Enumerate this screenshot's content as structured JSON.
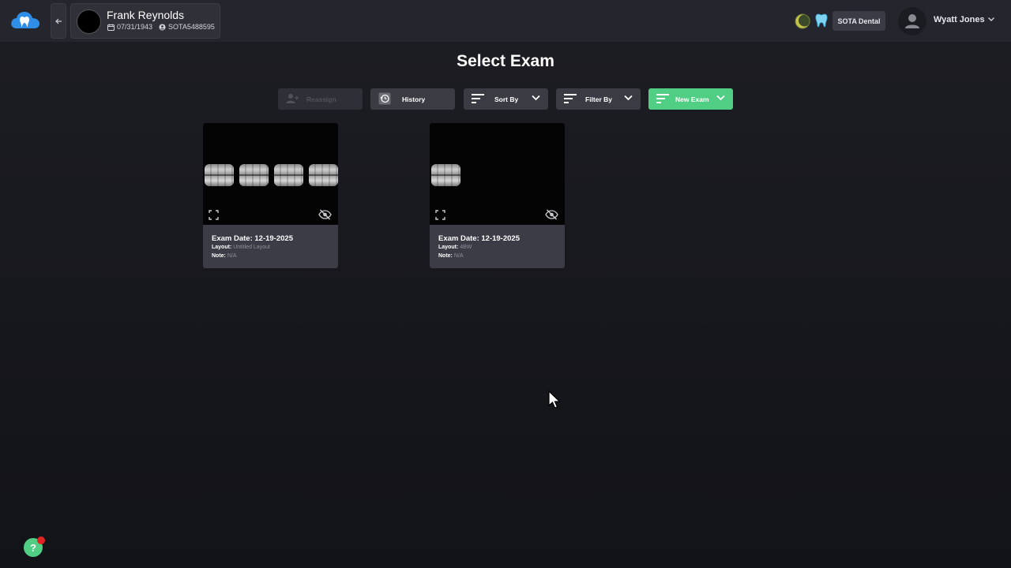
{
  "header": {
    "patient": {
      "name": "Frank Reynolds",
      "dob": "07/31/1943",
      "patient_id": "SOTA5488595"
    },
    "practice_label": "SOTA Dental",
    "user_name": "Wyatt Jones"
  },
  "page_title": "Select Exam",
  "toolbar": {
    "reassign_label": "Reassign",
    "history_label": "History",
    "sort_label": "Sort By",
    "filter_label": "Filter By",
    "new_exam_label": "New Exam"
  },
  "exams": [
    {
      "date_text": "Exam Date: 12-19-2025",
      "layout_label": "Layout:",
      "layout_value": "Untitled Layout",
      "note_label": "Note:",
      "note_value": "N/A",
      "image_count": 4
    },
    {
      "date_text": "Exam Date: 12-19-2025",
      "layout_label": "Layout:",
      "layout_value": "4BW",
      "note_label": "Note:",
      "note_value": "N/A",
      "image_count": 1
    }
  ],
  "help": {
    "label": "?"
  },
  "colors": {
    "accent_green": "#4fce84",
    "background": "#17181d",
    "topbar": "#25262d",
    "notification": "#e02424"
  },
  "icons": [
    "cloud-tooth-logo-icon",
    "arrow-left-icon",
    "calendar-icon",
    "user-id-icon",
    "moon-status-icon",
    "tooth-icon",
    "user-avatar-icon",
    "chevron-down-icon",
    "history-icon",
    "sort-icon",
    "filter-icon",
    "expand-icon",
    "eye-off-icon",
    "help-icon",
    "cursor-icon"
  ]
}
